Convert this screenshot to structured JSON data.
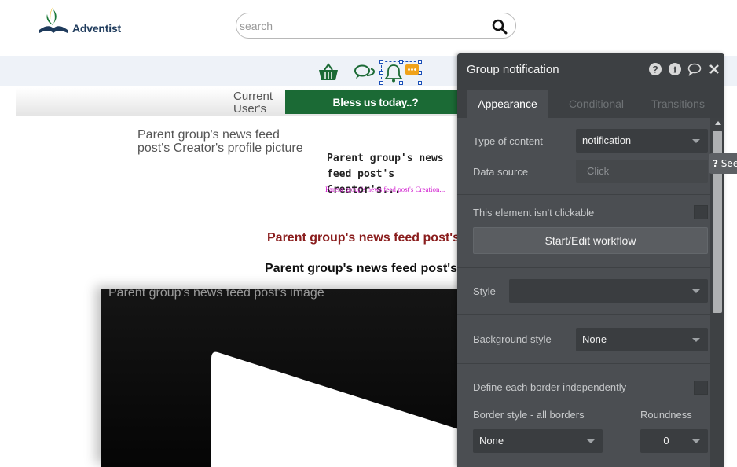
{
  "header": {
    "logo_text": "Adventist",
    "search_placeholder": "search"
  },
  "navbar": {
    "icons": [
      "basket-icon",
      "chat-bubbles-icon",
      "bell-icon"
    ]
  },
  "content": {
    "current_user_label": "Current User's",
    "bless_button_label": "Bless us today..?",
    "profile_picture_text": "Parent group's news feed post's Creator's profile picture",
    "creator_name": "Parent group's news feed post's Creator's...",
    "creation_date": "Parent group's news feed post's Creation...",
    "post_title": "Parent group's news feed post's ti",
    "post_body": "Parent group's news feed post's bo",
    "post_image_label": "Parent group's news feed post's image"
  },
  "panel": {
    "title": "Group notification",
    "tabs": [
      {
        "label": "Appearance",
        "active": true
      },
      {
        "label": "Conditional",
        "active": false
      },
      {
        "label": "Transitions",
        "active": false
      }
    ],
    "type_of_content_label": "Type of content",
    "type_of_content_value": "notification",
    "data_source_label": "Data source",
    "data_source_placeholder": "Click",
    "not_clickable_label": "This element isn't clickable",
    "not_clickable_checked": false,
    "workflow_button_label": "Start/Edit workflow",
    "style_label": "Style",
    "style_value": "",
    "background_style_label": "Background style",
    "background_style_value": "None",
    "border_independent_label": "Define each border independently",
    "border_independent_checked": false,
    "border_style_label": "Border style - all borders",
    "border_style_value": "None",
    "roundness_label": "Roundness",
    "roundness_value": "0"
  },
  "see_tab_label": "See"
}
